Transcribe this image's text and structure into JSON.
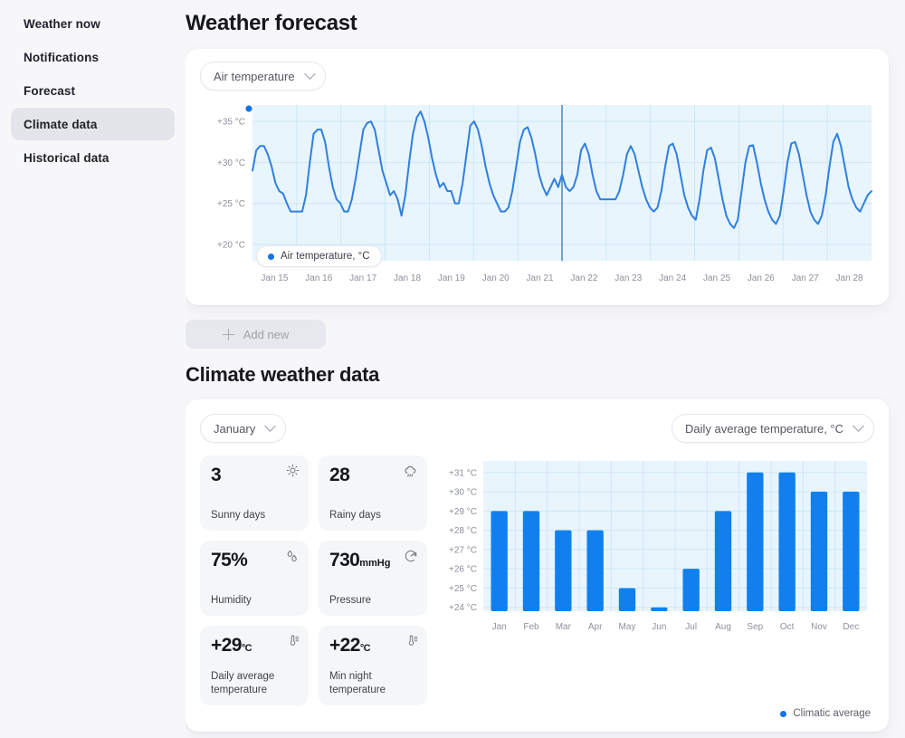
{
  "sidebar": {
    "items": [
      {
        "label": "Weather now",
        "active": false
      },
      {
        "label": "Notifications",
        "active": false
      },
      {
        "label": "Forecast",
        "active": false
      },
      {
        "label": "Climate data",
        "active": true
      },
      {
        "label": "Historical data",
        "active": false
      }
    ]
  },
  "page": {
    "title": "Weather forecast",
    "section_title": "Climate weather data"
  },
  "forecast": {
    "metric_select": "Air temperature",
    "legend": "Air temperature, °C",
    "add_new": "Add new"
  },
  "climate": {
    "month_select": "January",
    "metric_select": "Daily average temperature, °C",
    "legend": "Climatic average",
    "cards": [
      {
        "value": "3",
        "unit": "",
        "label": "Sunny days",
        "icon": "sun-icon"
      },
      {
        "value": "28",
        "unit": "",
        "label": "Rainy days",
        "icon": "rain-cloud-icon"
      },
      {
        "value": "75%",
        "unit": "",
        "label": "Humidity",
        "icon": "droplets-icon"
      },
      {
        "value": "730",
        "unit": "mmHg",
        "label": "Pressure",
        "icon": "pressure-gauge-icon"
      },
      {
        "value": "+29",
        "unit": "°C",
        "label": "Daily average temperature",
        "icon": "thermometer-icon"
      },
      {
        "value": "+22",
        "unit": "°C",
        "label": "Min night temperature",
        "icon": "thermometer-icon"
      }
    ]
  },
  "colors": {
    "accent": "#1673e6",
    "chart_bg": "#e8f5fd",
    "grid": "#cfe6f5",
    "sidebar_active": "#e4e5ea"
  },
  "chart_data": [
    {
      "type": "line",
      "title": "Air temperature",
      "name": "forecast-line-chart",
      "ylabel": "°C",
      "ylim": [
        18,
        37
      ],
      "yticks": [
        20,
        25,
        30,
        35
      ],
      "ytick_labels": [
        "+20 °C",
        "+25 °C",
        "+30 °C",
        "+35 °C"
      ],
      "categories": [
        "Jan 15",
        "Jan 16",
        "Jan 17",
        "Jan 18",
        "Jan 19",
        "Jan 20",
        "Jan 21",
        "Jan 22",
        "Jan 23",
        "Jan 24",
        "Jan 25",
        "Jan 26",
        "Jan 27",
        "Jan 28"
      ],
      "legend": "Air temperature, °C",
      "legend_position": "inside-bottom-left",
      "grid": true,
      "cursor_x_category": "Jan 22",
      "series": [
        {
          "name": "Air temperature, °C",
          "color": "#2f7fe0",
          "values": [
            29.0,
            31.5,
            32.0,
            32.0,
            31.0,
            29.5,
            27.5,
            26.5,
            26.2,
            25.0,
            24.0,
            24.0,
            24.0,
            24.0,
            26.0,
            30.0,
            33.5,
            34.0,
            34.0,
            32.5,
            29.5,
            27.0,
            25.5,
            25.0,
            24.0,
            24.0,
            25.5,
            28.0,
            31.0,
            34.0,
            34.8,
            35.0,
            34.0,
            31.5,
            29.0,
            27.5,
            26.0,
            26.5,
            25.5,
            23.5,
            26.0,
            30.0,
            33.5,
            35.5,
            36.2,
            35.0,
            33.0,
            30.5,
            28.5,
            27.0,
            27.5,
            26.5,
            26.5,
            25.0,
            25.0,
            27.5,
            31.0,
            34.5,
            35.0,
            34.0,
            32.0,
            29.5,
            27.5,
            26.0,
            25.0,
            24.0,
            24.0,
            24.5,
            26.5,
            29.5,
            32.5,
            34.0,
            34.3,
            33.0,
            31.0,
            28.5,
            27.0,
            26.0,
            27.0,
            28.0,
            27.0,
            28.5,
            27.0,
            26.5,
            27.0,
            28.5,
            31.5,
            32.3,
            31.0,
            28.5,
            26.5,
            25.5,
            25.5,
            25.5,
            25.5,
            25.5,
            26.5,
            28.5,
            31.0,
            32.0,
            31.0,
            29.0,
            27.0,
            25.5,
            24.5,
            24.0,
            24.5,
            26.5,
            29.5,
            32.0,
            32.3,
            31.0,
            28.5,
            26.0,
            24.5,
            23.5,
            23.0,
            25.5,
            29.0,
            31.5,
            31.8,
            30.5,
            28.0,
            25.5,
            23.5,
            22.5,
            22.0,
            23.0,
            26.5,
            30.0,
            32.0,
            32.1,
            30.0,
            27.5,
            25.5,
            24.0,
            23.0,
            22.5,
            23.5,
            26.5,
            30.0,
            32.3,
            32.5,
            31.0,
            28.5,
            26.0,
            24.0,
            23.0,
            22.5,
            23.5,
            26.0,
            29.5,
            32.5,
            33.5,
            32.0,
            29.5,
            27.0,
            25.5,
            24.5,
            24.0,
            25.0,
            26.0,
            26.5
          ]
        }
      ]
    },
    {
      "type": "bar",
      "name": "climate-bar-chart",
      "title": "Daily average temperature, °C",
      "categories": [
        "Jan",
        "Feb",
        "Mar",
        "Apr",
        "May",
        "Jun",
        "Jul",
        "Aug",
        "Sep",
        "Oct",
        "Nov",
        "Dec"
      ],
      "values": [
        29,
        29,
        28,
        28,
        25,
        24,
        26,
        29,
        31,
        31,
        30,
        30
      ],
      "ylabel": "°C",
      "ylim": [
        23.8,
        31.6
      ],
      "yticks": [
        24,
        25,
        26,
        27,
        28,
        29,
        30,
        31
      ],
      "ytick_labels": [
        "+24 °C",
        "+25 °C",
        "+26 °C",
        "+27 °C",
        "+28 °C",
        "+29 °C",
        "+30 °C",
        "+31 °C"
      ],
      "legend": "Climatic average",
      "legend_position": "bottom-right",
      "grid": true,
      "bar_color": "#1080f0"
    }
  ]
}
